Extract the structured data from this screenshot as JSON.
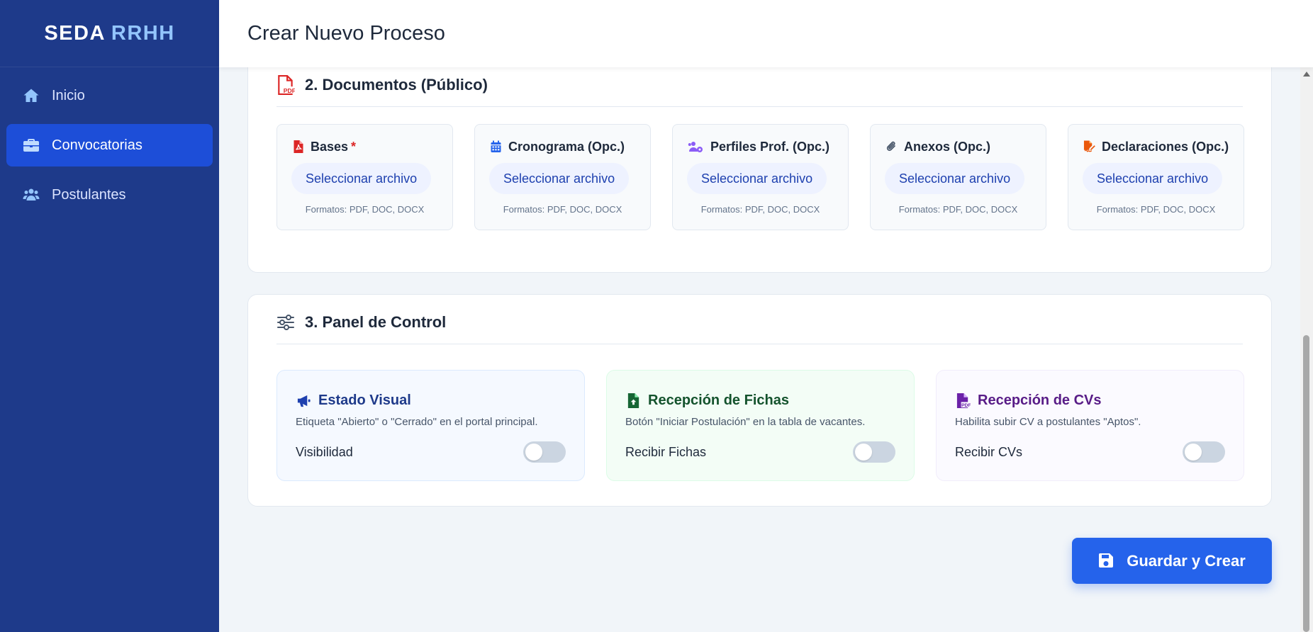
{
  "brand": {
    "name": "SEDA",
    "accent": "RRHH"
  },
  "sidebar": {
    "items": [
      {
        "label": "Inicio",
        "icon": "home-icon",
        "active": false
      },
      {
        "label": "Convocatorias",
        "icon": "briefcase-icon",
        "active": true
      },
      {
        "label": "Postulantes",
        "icon": "users-icon",
        "active": false
      }
    ]
  },
  "header": {
    "title": "Crear Nuevo Proceso"
  },
  "documents": {
    "title": "2. Documentos (Público)",
    "icon": "file-pdf-icon",
    "items": [
      {
        "label": "Bases",
        "required_mark": "*",
        "icon": "file-pdf-icon",
        "icon_color": "#dc2626",
        "button": "Seleccionar archivo",
        "formats": "Formatos: PDF, DOC, DOCX"
      },
      {
        "label": "Cronograma (Opc.)",
        "icon": "calendar-icon",
        "icon_color": "#2563eb",
        "button": "Seleccionar archivo",
        "formats": "Formatos: PDF, DOC, DOCX"
      },
      {
        "label": "Perfiles Prof. (Opc.)",
        "icon": "users-cog-icon",
        "icon_color": "#8b5cf6",
        "button": "Seleccionar archivo",
        "formats": "Formatos: PDF, DOC, DOCX"
      },
      {
        "label": "Anexos (Opc.)",
        "icon": "paperclip-icon",
        "icon_color": "#475569",
        "button": "Seleccionar archivo",
        "formats": "Formatos: PDF, DOC, DOCX"
      },
      {
        "label": "Declaraciones (Opc.)",
        "icon": "file-signature-icon",
        "icon_color": "#ea580c",
        "button": "Seleccionar archivo",
        "formats": "Formatos: PDF, DOC, DOCX"
      }
    ]
  },
  "panel": {
    "title": "3. Panel de Control",
    "icon": "sliders-icon",
    "items": [
      {
        "title": "Estado Visual",
        "icon": "megaphone-icon",
        "description": "Etiqueta \"Abierto\" o \"Cerrado\" en el portal principal.",
        "toggle_label": "Visibilidad",
        "enabled": false
      },
      {
        "title": "Recepción de Fichas",
        "icon": "file-upload-icon",
        "description": "Botón \"Iniciar Postulación\" en la tabla de vacantes.",
        "toggle_label": "Recibir Fichas",
        "enabled": false
      },
      {
        "title": "Recepción de CVs",
        "icon": "file-pdf-icon",
        "description": "Habilita subir CV a postulantes \"Aptos\".",
        "toggle_label": "Recibir CVs",
        "enabled": false
      }
    ]
  },
  "actions": {
    "save_label": "Guardar y Crear",
    "save_icon": "floppy-disk-icon"
  },
  "colors": {
    "sidebar_bg": "#1e3a8a",
    "active_item": "#1d4ed8",
    "primary": "#2563eb",
    "brand_accent": "#93c5fd"
  }
}
